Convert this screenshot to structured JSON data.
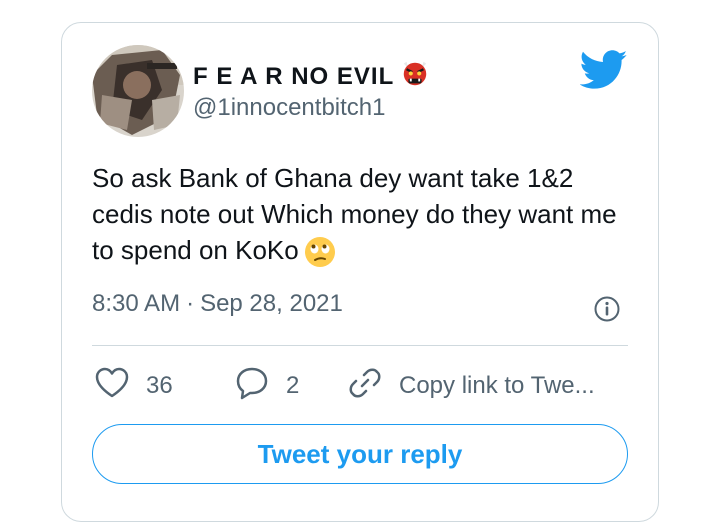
{
  "tweet": {
    "display_name": "F E A R NO EVIL",
    "name_emoji": "red-ogre-mask-emoji",
    "handle": "@1innocentbitch1",
    "text": "So ask Bank of Ghana dey want  take 1&2 cedis note out Which money do they want me to spend on KoKo",
    "text_emoji": "face-with-rolling-eyes-emoji",
    "time": "8:30 AM",
    "separator": "·",
    "date": "Sep 28, 2021"
  },
  "actions": {
    "like_count": "36",
    "reply_count": "2",
    "copy_link_label": "Copy link to Twe..."
  },
  "reply_button_label": "Tweet your reply",
  "colors": {
    "accent": "#1d9bf0",
    "text_primary": "#0f1419",
    "text_secondary": "#536471",
    "border": "#cfd9de"
  }
}
